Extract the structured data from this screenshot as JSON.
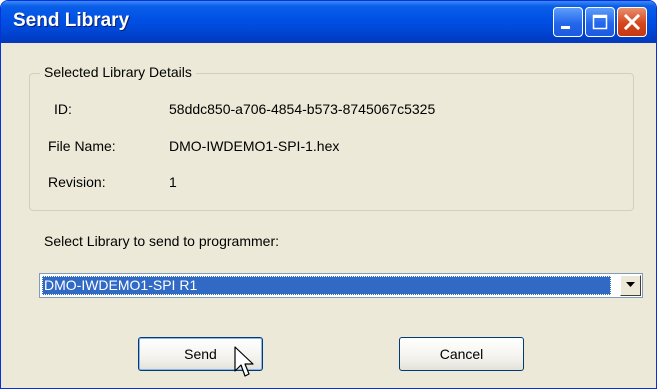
{
  "window": {
    "title": "Send Library",
    "minimize_icon": "minimize-icon",
    "maximize_icon": "maximize-icon",
    "close_icon": "close-icon"
  },
  "details": {
    "group_label": "Selected Library Details",
    "id_label": "ID:",
    "id_value": "58ddc850-a706-4854-b573-8745067c5325",
    "file_name_label": "File Name:",
    "file_name_value": "DMO-IWDEMO1-SPI-1.hex",
    "revision_label": "Revision:",
    "revision_value": "1"
  },
  "select": {
    "label": "Select Library to send to programmer:",
    "selected_value": "DMO-IWDEMO1-SPI R1",
    "arrow_icon": "chevron-down-icon"
  },
  "buttons": {
    "send_label": "Send",
    "cancel_label": "Cancel"
  },
  "cursor_icon": "mouse-pointer-icon"
}
